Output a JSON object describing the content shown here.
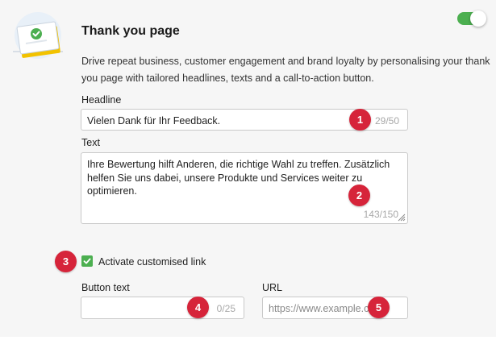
{
  "section": {
    "title": "Thank you page",
    "description": "Drive repeat business, customer engagement and brand loyalty by personalising your thank you page with tailored headlines, texts and a call-to-action button.",
    "enabled": true
  },
  "headline": {
    "label": "Headline",
    "value": "Vielen Dank für Ihr Feedback.",
    "counter": "29/50",
    "badge": "1"
  },
  "text": {
    "label": "Text",
    "value": "Ihre Bewertung hilft Anderen, die richtige Wahl zu treffen. Zusätzlich helfen Sie uns dabei, unsere Produkte und Services weiter zu optimieren.",
    "counter": "143/150",
    "badge": "2"
  },
  "custom_link": {
    "label": "Activate customised link",
    "checked": true,
    "badge": "3"
  },
  "button_text": {
    "label": "Button text",
    "value": "",
    "counter": "0/25",
    "badge": "4"
  },
  "url": {
    "label": "URL",
    "placeholder": "https://www.example.c",
    "badge": "5"
  },
  "colors": {
    "accent_green": "#4caf50",
    "badge_red": "#d6243a",
    "panel_bg": "#f6f6f6"
  }
}
